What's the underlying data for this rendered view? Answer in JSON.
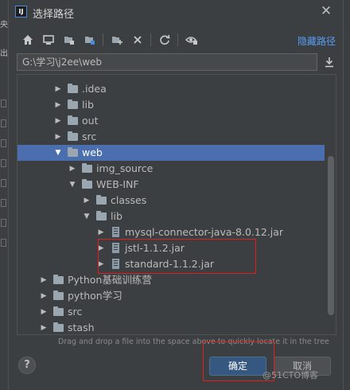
{
  "window": {
    "title": "选择路径"
  },
  "background_left": [
    "央",
    "出"
  ],
  "toolbar": {
    "buttons": [
      {
        "icon": "home-icon"
      },
      {
        "icon": "desktop-icon"
      },
      {
        "icon": "project-folder-icon"
      },
      {
        "icon": "module-folder-icon"
      },
      {
        "icon": "new-folder-icon"
      },
      {
        "icon": "delete-icon"
      },
      {
        "icon": "refresh-icon"
      },
      {
        "icon": "show-hidden-icon"
      }
    ],
    "hide_path_label": "隐藏路径"
  },
  "path_field": {
    "value": "G:\\学习\\j2ee\\web"
  },
  "tree": {
    "items": [
      {
        "label": ".idea",
        "depth": 3,
        "expanded": false,
        "type": "folder",
        "selected": false
      },
      {
        "label": "lib",
        "depth": 3,
        "expanded": false,
        "type": "folder",
        "selected": false
      },
      {
        "label": "out",
        "depth": 3,
        "expanded": false,
        "type": "folder",
        "selected": false
      },
      {
        "label": "src",
        "depth": 3,
        "expanded": false,
        "type": "folder",
        "selected": false
      },
      {
        "label": "web",
        "depth": 3,
        "expanded": true,
        "type": "folder",
        "selected": true
      },
      {
        "label": "img_source",
        "depth": 4,
        "expanded": false,
        "type": "folder",
        "selected": false
      },
      {
        "label": "WEB-INF",
        "depth": 4,
        "expanded": true,
        "type": "folder",
        "selected": false
      },
      {
        "label": "classes",
        "depth": 5,
        "expanded": false,
        "type": "folder",
        "selected": false
      },
      {
        "label": "lib",
        "depth": 5,
        "expanded": true,
        "type": "folder",
        "selected": false
      },
      {
        "label": "mysql-connector-java-8.0.12.jar",
        "depth": 6,
        "expanded": false,
        "type": "jar",
        "selected": false
      },
      {
        "label": "jstl-1.1.2.jar",
        "depth": 6,
        "expanded": false,
        "type": "jar",
        "selected": false
      },
      {
        "label": "standard-1.1.2.jar",
        "depth": 6,
        "expanded": false,
        "type": "jar",
        "selected": false
      },
      {
        "label": "Python基础训练营",
        "depth": 2,
        "expanded": false,
        "type": "folder",
        "selected": false
      },
      {
        "label": "python学习",
        "depth": 2,
        "expanded": false,
        "type": "folder",
        "selected": false
      },
      {
        "label": "src",
        "depth": 2,
        "expanded": false,
        "type": "folder",
        "selected": false
      },
      {
        "label": "stash",
        "depth": 2,
        "expanded": false,
        "type": "folder",
        "selected": false
      }
    ]
  },
  "hint": "Drag and drop a file into the space above to quickly locate it in the tree",
  "buttons": {
    "help": "?",
    "ok": "确定",
    "cancel": "取消"
  },
  "watermark": "@51CTO博客",
  "colors": {
    "background": "#3c3f41",
    "selection": "#4b6eaf",
    "link": "#589df6",
    "ok_button": "#365880",
    "annotation": "#e02020"
  }
}
